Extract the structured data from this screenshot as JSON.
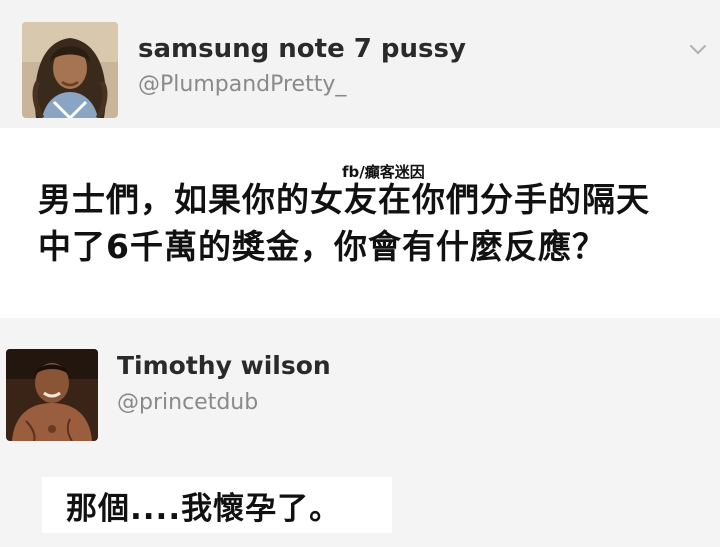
{
  "tweets": [
    {
      "display_name": "samsung note 7 pussy",
      "handle": "@PlumpandPretty_",
      "avatar_icon": "profile-photo-woman"
    },
    {
      "display_name": "Timothy wilson",
      "handle": "@princetdub",
      "avatar_icon": "profile-photo-man"
    }
  ],
  "watermark": "fb/癲客迷因",
  "post_lines": [
    "男士們，如果你的女友在你們分手的隔天",
    "中了6千萬的獎金，你會有什麼反應？"
  ],
  "reply": "那個....我懷孕了。",
  "icons": {
    "menu": "chevron-down-icon"
  },
  "colors": {
    "name": "#2a2a2a",
    "handle": "#8a8a8a",
    "text": "#111111"
  }
}
